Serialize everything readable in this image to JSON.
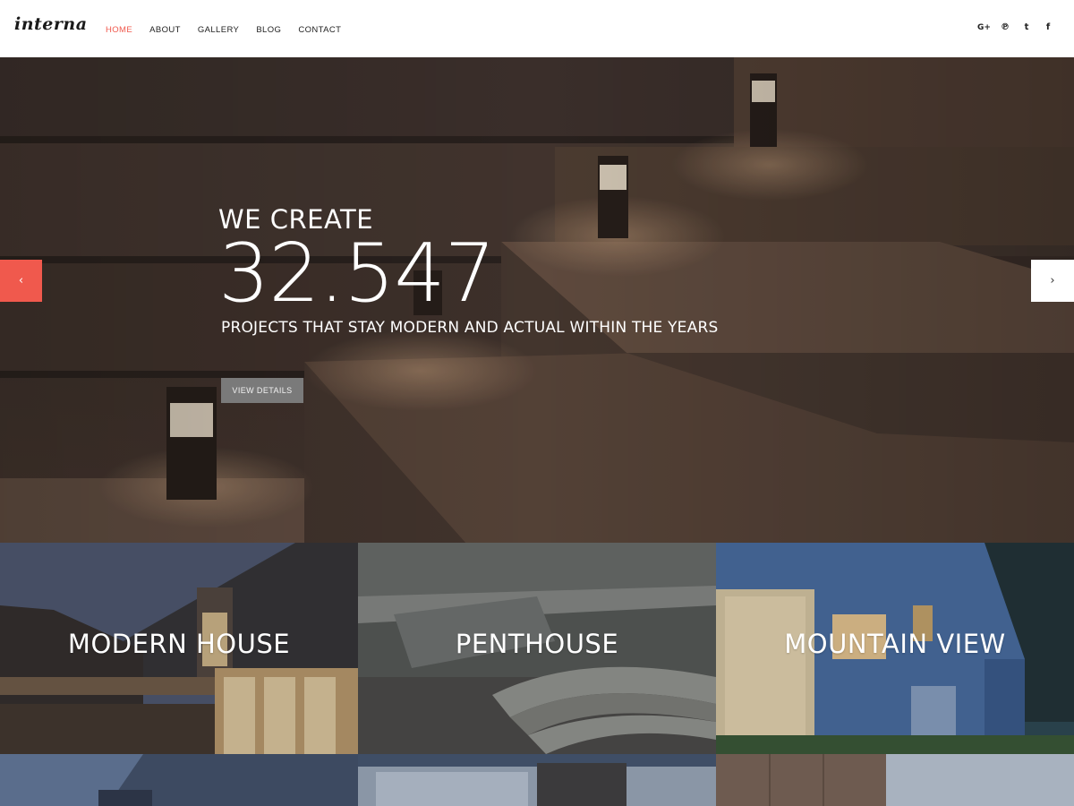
{
  "header": {
    "logo": "interna",
    "nav": [
      {
        "label": "HOME",
        "active": true
      },
      {
        "label": "ABOUT",
        "active": false
      },
      {
        "label": "GALLERY",
        "active": false
      },
      {
        "label": "BLOG",
        "active": false
      },
      {
        "label": "CONTACT",
        "active": false
      }
    ],
    "social": [
      {
        "icon": "google-plus-icon",
        "glyph": "G+"
      },
      {
        "icon": "pinterest-icon",
        "glyph": "℗"
      },
      {
        "icon": "twitter-icon",
        "glyph": "t"
      },
      {
        "icon": "facebook-icon",
        "glyph": "f"
      }
    ]
  },
  "hero": {
    "kicker": "WE CREATE",
    "number": "32.547",
    "subtitle": "PROJECTS THAT STAY MODERN AND ACTUAL WITHIN THE YEARS",
    "button_label": "VIEW DETAILS",
    "prev_glyph": "‹",
    "next_glyph": "›"
  },
  "tiles": [
    {
      "title": "MODERN HOUSE"
    },
    {
      "title": "PENTHOUSE"
    },
    {
      "title": "MOUNTAIN VIEW"
    }
  ],
  "colors": {
    "accent": "#f0594d",
    "text_dark": "#222222",
    "button_gray": "#7a7a7a"
  }
}
